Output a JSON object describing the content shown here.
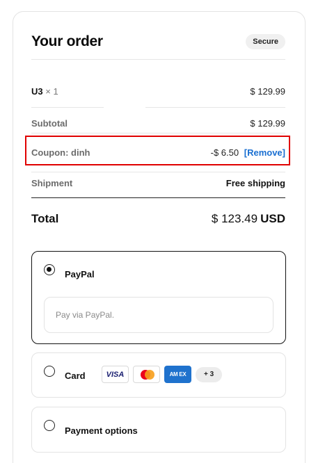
{
  "order": {
    "title": "Your order",
    "badge": "Secure",
    "item": {
      "name": "U3",
      "qty": "× 1",
      "price": "$ 129.99"
    },
    "subtotal": {
      "label": "Subtotal",
      "value": "$ 129.99"
    },
    "coupon": {
      "label": "Coupon: dinh",
      "discount": "-$ 6.50",
      "remove": "[Remove]"
    },
    "shipment": {
      "label": "Shipment",
      "value": "Free shipping"
    },
    "total": {
      "label": "Total",
      "value": "$ 123.49",
      "currency": "USD"
    }
  },
  "payment_methods": [
    {
      "label": "PayPal",
      "selected": true,
      "description": "Pay via PayPal."
    },
    {
      "label": "Card",
      "selected": false,
      "logos": [
        "visa-logo",
        "mastercard-logo",
        "amex-logo"
      ],
      "more": "+ 3",
      "visa_text": "VISA",
      "amex_text": "AM EX"
    },
    {
      "label": "Payment options",
      "selected": false
    }
  ],
  "colors": {
    "highlight_border": "#e00000",
    "link": "#1a6fd1"
  }
}
